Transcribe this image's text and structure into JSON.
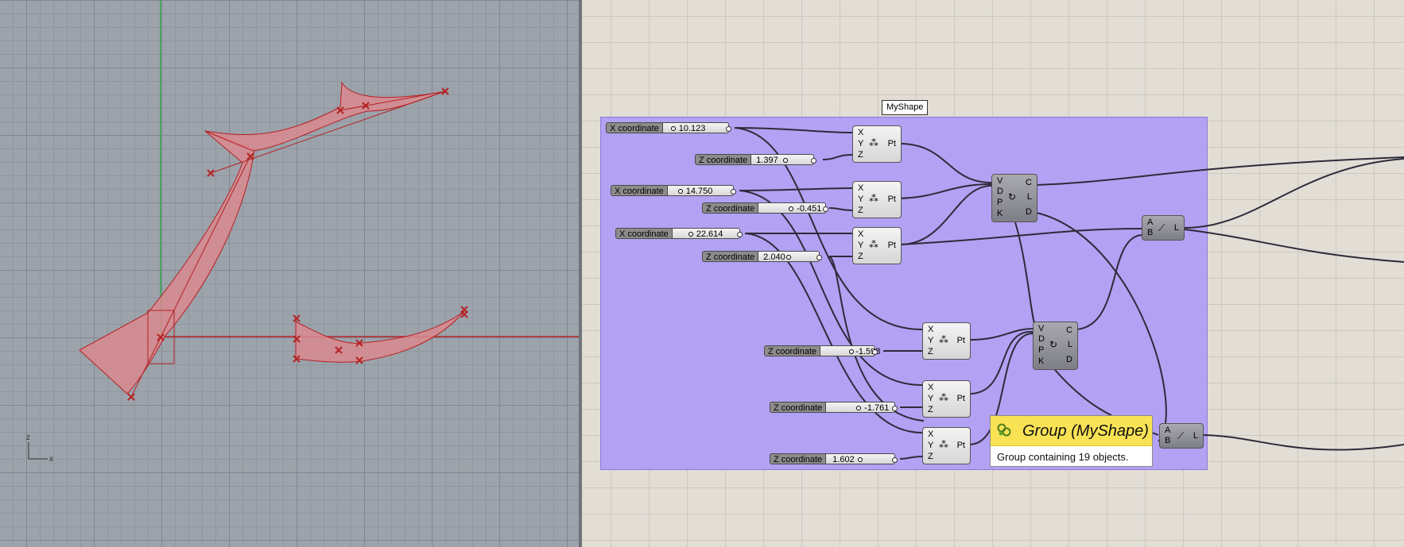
{
  "viewport": {
    "axis_icon": {
      "z_label": "z",
      "x_label": "x"
    },
    "colors": {
      "background": "#9ca3ab",
      "curve": "#b52224",
      "surface": "#d98a8e",
      "y_axis": "#2fa84a",
      "x_axis": "#b52224"
    }
  },
  "canvas": {
    "group_label": "MyShape",
    "group_color": "#b3a1f3",
    "sliders": [
      {
        "label": "X coordinate",
        "value": "10.123"
      },
      {
        "label": "Z coordinate",
        "value": "1.397"
      },
      {
        "label": "X coordinate",
        "value": "14.750"
      },
      {
        "label": "Z coordinate",
        "value": "-0.451"
      },
      {
        "label": "X coordinate",
        "value": "22.614"
      },
      {
        "label": "Z coordinate",
        "value": "2.040"
      },
      {
        "label": "Z coordinate",
        "value": "-1.598"
      },
      {
        "label": "Z coordinate",
        "value": "-1.761"
      },
      {
        "label": "Z coordinate",
        "value": "1.602"
      }
    ],
    "point_component": {
      "inputs": [
        "X",
        "Y",
        "Z"
      ],
      "output": "Pt",
      "icon": "point-xyz-icon"
    },
    "circle_component": {
      "inputs": [
        "V",
        "D",
        "P",
        "K"
      ],
      "outputs": [
        "C",
        "L",
        "D"
      ],
      "icon": "curve-icon"
    },
    "line_component": {
      "inputs": [
        "A",
        "B"
      ],
      "output": "L",
      "icon": "line-icon"
    },
    "tooltip": {
      "title": "Group (MyShape)",
      "description": "Group containing 19 objects.",
      "icon": "group-icon"
    }
  }
}
